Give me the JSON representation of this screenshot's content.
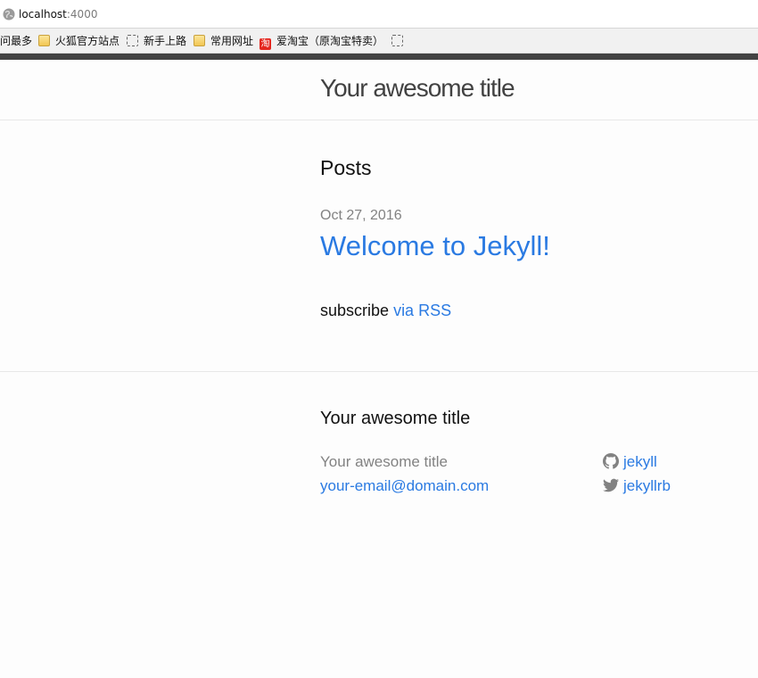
{
  "browser": {
    "url_host": "localhost",
    "url_port": ":4000",
    "bookmarks": [
      {
        "label": "访问最多",
        "icon": "none"
      },
      {
        "label": "火狐官方站点",
        "icon": "folder-icon"
      },
      {
        "label": "新手上路",
        "icon": "blank-page-icon"
      },
      {
        "label": "常用网址",
        "icon": "folder-icon"
      },
      {
        "label": "爱淘宝（原淘宝特卖）",
        "icon": "taobao-icon",
        "icon_text": "淘"
      },
      {
        "label": "",
        "icon": "blank-page-icon"
      }
    ]
  },
  "header": {
    "site_title": "Your awesome title"
  },
  "main": {
    "posts_heading": "Posts",
    "posts": [
      {
        "date": "Oct 27, 2016",
        "title": "Welcome to Jekyll!"
      }
    ],
    "rss_prefix": "subscribe",
    "rss_link": "via RSS"
  },
  "footer": {
    "heading": "Your awesome title",
    "name": "Your awesome title",
    "email": "your-email@domain.com",
    "github": "jekyll",
    "twitter": "jekyllrb"
  },
  "colors": {
    "link": "#2a7ae2",
    "muted": "#828282",
    "title": "#424242"
  }
}
